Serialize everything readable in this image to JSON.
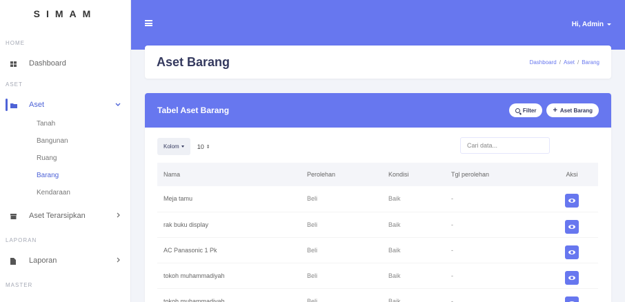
{
  "app": {
    "brand": "SIMAM"
  },
  "sidebar": {
    "home_title": "HOME",
    "dashboard": "Dashboard",
    "aset_title": "ASET",
    "aset": "Aset",
    "aset_subitems": [
      "Tanah",
      "Bangunan",
      "Ruang",
      "Barang",
      "Kendaraan"
    ],
    "aset_terarsipkan": "Aset Terarsipkan",
    "laporan_title": "LAPORAN",
    "laporan": "Laporan",
    "master_title": "MASTER"
  },
  "topbar": {
    "user": "Hi, Admin"
  },
  "header": {
    "title": "Aset Barang",
    "breadcrumb": [
      "Dashboard",
      "Aset",
      "Barang"
    ]
  },
  "card": {
    "title": "Tabel Aset Barang",
    "filter_label": "Filter",
    "add_label": "Aset Barang",
    "kolom_label": "Kolom",
    "per_page": "10",
    "search_placeholder": "Cari data..."
  },
  "table": {
    "columns": [
      "Nama",
      "Perolehan",
      "Kondisi",
      "Tgl perolehan",
      "Aksi"
    ],
    "rows": [
      {
        "nama": "Meja tamu",
        "perolehan": "Beli",
        "kondisi": "Baik",
        "tgl": "-"
      },
      {
        "nama": "rak buku display",
        "perolehan": "Beli",
        "kondisi": "Baik",
        "tgl": "-"
      },
      {
        "nama": "AC Panasonic 1 Pk",
        "perolehan": "Beli",
        "kondisi": "Baik",
        "tgl": "-"
      },
      {
        "nama": "tokoh muhammadiyah",
        "perolehan": "Beli",
        "kondisi": "Baik",
        "tgl": "-"
      },
      {
        "nama": "tokoh muhammadiyah",
        "perolehan": "Beli",
        "kondisi": "Baik",
        "tgl": "-"
      }
    ]
  },
  "colors": {
    "primary": "#6777ef",
    "active": "#4e63d7"
  }
}
